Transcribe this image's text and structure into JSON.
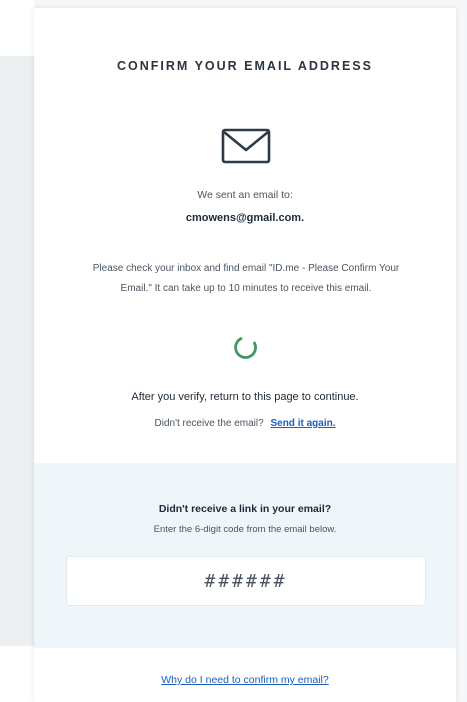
{
  "card": {
    "title": "CONFIRM YOUR EMAIL ADDRESS",
    "icon": "envelope-icon",
    "sent_text": "We sent an email to:",
    "email": "cmowens@gmail.com.",
    "instructions": "Please check your inbox and find email \"ID.me - Please Confirm Your Email.\" It can take up to 10 minutes to receive this email.",
    "loading_icon": "spinner-icon",
    "after_verify": "After you verify, return to this page to continue.",
    "resend_prompt": "Didn't receive the email?",
    "resend_link": "Send it again."
  },
  "code_section": {
    "heading": "Didn't receive a link in your email?",
    "subtext": "Enter the 6-digit code from the email below.",
    "input_placeholder": "######",
    "input_value": ""
  },
  "footer": {
    "why_link": "Why do I need to confirm my email?"
  },
  "colors": {
    "link": "#1b5fb8",
    "spinner": "#3c9a5f",
    "code_section_bg": "#eef6fa",
    "text_dark": "#1e2a36"
  }
}
